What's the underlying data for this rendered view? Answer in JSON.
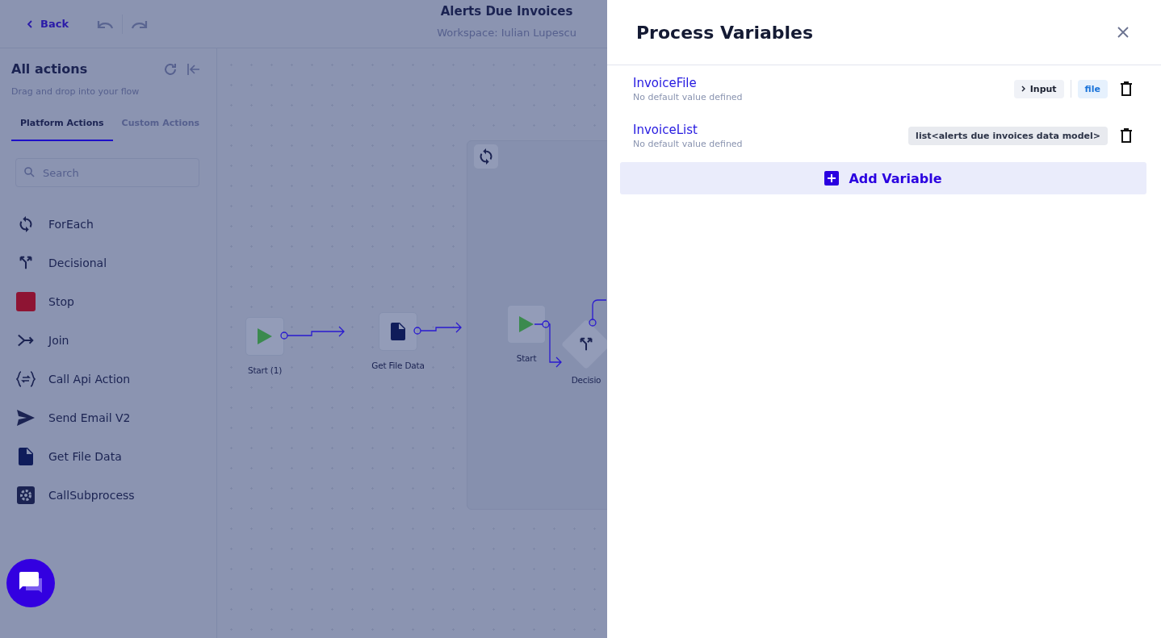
{
  "header": {
    "back": "Back",
    "title": "Alerts Due Invoices",
    "subtitle": "Workspace: Iulian Lupescu"
  },
  "sidebar": {
    "title": "All actions",
    "hint": "Drag and drop into your flow",
    "tabs": [
      {
        "label": "Platform Actions",
        "selected": true
      },
      {
        "label": "Custom Actions",
        "selected": false
      }
    ],
    "search": {
      "placeholder": "Search"
    },
    "items": [
      {
        "label": "ForEach",
        "kind": "foreach"
      },
      {
        "label": "Decisional",
        "kind": "decision"
      },
      {
        "label": "Stop",
        "kind": "stop"
      },
      {
        "label": "Join",
        "kind": "join"
      },
      {
        "label": "Call Api Action",
        "kind": "api"
      },
      {
        "label": "Send Email V2",
        "kind": "email"
      },
      {
        "label": "Get File Data",
        "kind": "file"
      },
      {
        "label": "CallSubprocess",
        "kind": "subprocess"
      }
    ]
  },
  "canvas": {
    "nodes": [
      {
        "label": "Start (1)",
        "kind": "start"
      },
      {
        "label": "Get File Data",
        "kind": "file"
      },
      {
        "label": "Start",
        "kind": "start"
      },
      {
        "label": "Decisio",
        "kind": "decision"
      }
    ]
  },
  "drawer": {
    "title": "Process Variables",
    "variables": [
      {
        "name": "InvoiceFile",
        "hint": "No default value defined",
        "direction": "Input",
        "type": "file",
        "kind": "file"
      },
      {
        "name": "InvoiceList",
        "hint": "No default value defined",
        "type": "list<alerts due invoices data model>",
        "kind": "list"
      }
    ],
    "add_button": "Add Variable"
  }
}
